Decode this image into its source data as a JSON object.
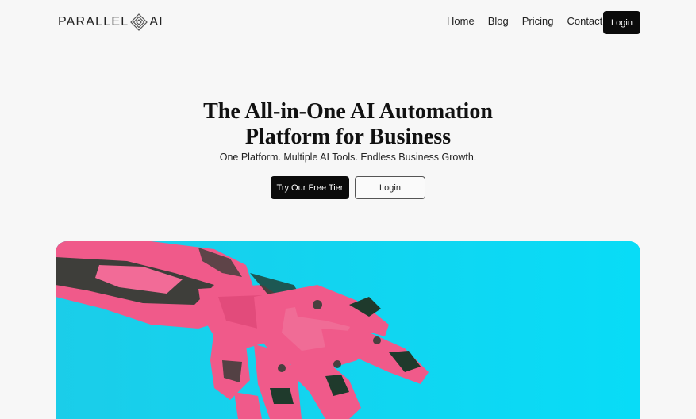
{
  "brand": {
    "name_left": "PARALLEL",
    "name_right": "AI",
    "logo_icon": "diamond-logo-icon"
  },
  "nav": {
    "links": [
      "Home",
      "Blog",
      "Pricing",
      "Contact"
    ],
    "login_label": "Login"
  },
  "hero": {
    "title_line1": "The All-in-One AI Automation",
    "title_line2": "Platform for Business",
    "subtitle": "One Platform. Multiple AI Tools. Endless Business Growth.",
    "primary_cta": "Try Our Free Tier",
    "secondary_cta": "Login",
    "image_subject": "robot-hand-illustration"
  },
  "colors": {
    "background": "#f7f7f7",
    "button_dark": "#0b0b0b",
    "image_bg": "#1ad3f3",
    "robot_pink": "#f05a8a",
    "robot_dark": "#1f3a2c"
  }
}
